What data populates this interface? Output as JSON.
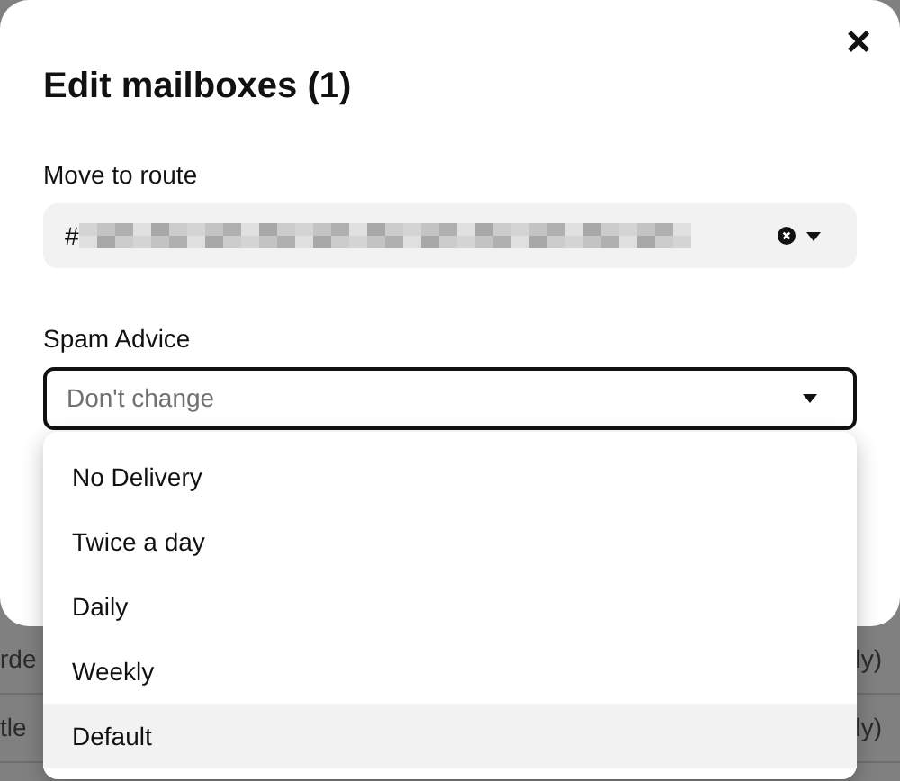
{
  "dialog": {
    "title": "Edit mailboxes (1)",
    "close": "×",
    "fields": [
      {
        "kind": "combo",
        "label": "Move to route",
        "value": "#",
        "redacted": true,
        "clear": true
      },
      {
        "kind": "select",
        "label": "Spam Advice",
        "placeholder": "Don't change",
        "focused": true
      }
    ]
  },
  "dropdown": {
    "options": [
      {
        "label": "No Delivery",
        "selected": false
      },
      {
        "label": "Twice a day",
        "selected": false
      },
      {
        "label": "Daily",
        "selected": false
      },
      {
        "label": "Weekly",
        "selected": false
      },
      {
        "label": "Default",
        "selected": true
      }
    ]
  },
  "background_table": {
    "rows": [
      {
        "column_1": "rde",
        "column_2": "ly)"
      },
      {
        "column_1": "tle",
        "column_2": "ly)"
      }
    ]
  }
}
